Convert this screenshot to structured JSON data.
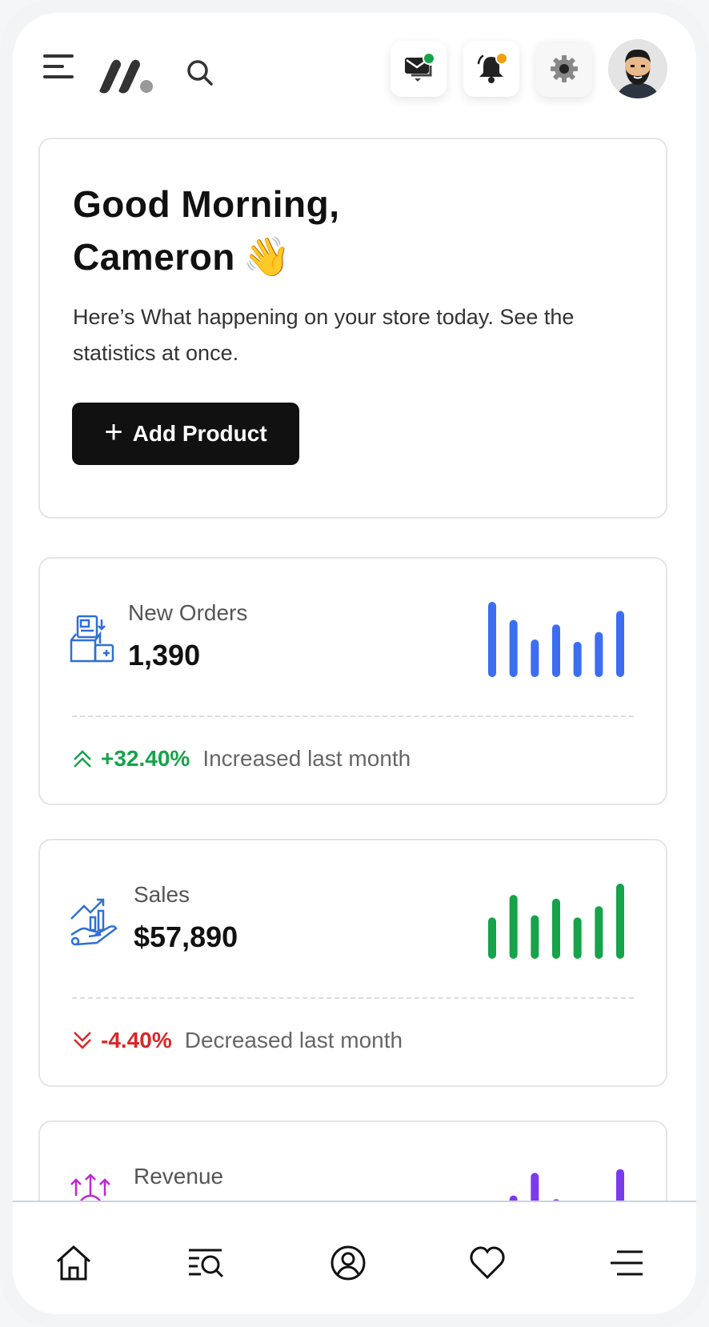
{
  "header": {
    "menu_icon": "hamburger-menu-icon",
    "logo_icon": "brand-logo-icon",
    "search_icon": "search-icon",
    "messages": {
      "icon": "mail-icon",
      "badge_color": "#16a34a"
    },
    "notifications": {
      "icon": "bell-icon",
      "badge_color": "#f59e0b"
    },
    "settings": {
      "icon": "gear-icon"
    },
    "avatar": "user-avatar"
  },
  "welcome": {
    "greeting_line1": "Good Morning,",
    "greeting_line2": "Cameron",
    "wave_emoji": "👋",
    "subtitle": "Here’s What happening on your store today. See the statistics at once.",
    "add_button_icon": "+",
    "add_button_label": "Add Product"
  },
  "stats": [
    {
      "label": "New Orders",
      "value": "1,390",
      "icon": "box-orders-icon",
      "change": "+32.40%",
      "change_note": "Increased last month",
      "trend": "up",
      "trend_color": "#16a34a",
      "bar_color": "#3b6ef2",
      "bars": [
        1.0,
        0.76,
        0.5,
        0.7,
        0.47,
        0.6,
        0.88
      ]
    },
    {
      "label": "Sales",
      "value": "$57,890",
      "icon": "hand-growth-icon",
      "change": "-4.40%",
      "change_note": "Decreased last month",
      "trend": "down",
      "trend_color": "#dc2626",
      "bar_color": "#16a34a",
      "bars": [
        0.55,
        0.85,
        0.58,
        0.8,
        0.55,
        0.7,
        1.0
      ]
    },
    {
      "label": "Revenue",
      "icon": "revenue-arrows-icon",
      "bar_color": "#7c3aed",
      "bars": [
        0.3,
        0.6,
        0.9,
        0.55,
        0.25,
        0.4,
        0.95
      ]
    }
  ],
  "bottom_nav": [
    {
      "name": "home",
      "icon": "home-icon"
    },
    {
      "name": "search",
      "icon": "search-list-icon"
    },
    {
      "name": "profile",
      "icon": "user-circle-icon"
    },
    {
      "name": "favorites",
      "icon": "heart-icon"
    },
    {
      "name": "menu",
      "icon": "menu-icon"
    }
  ]
}
